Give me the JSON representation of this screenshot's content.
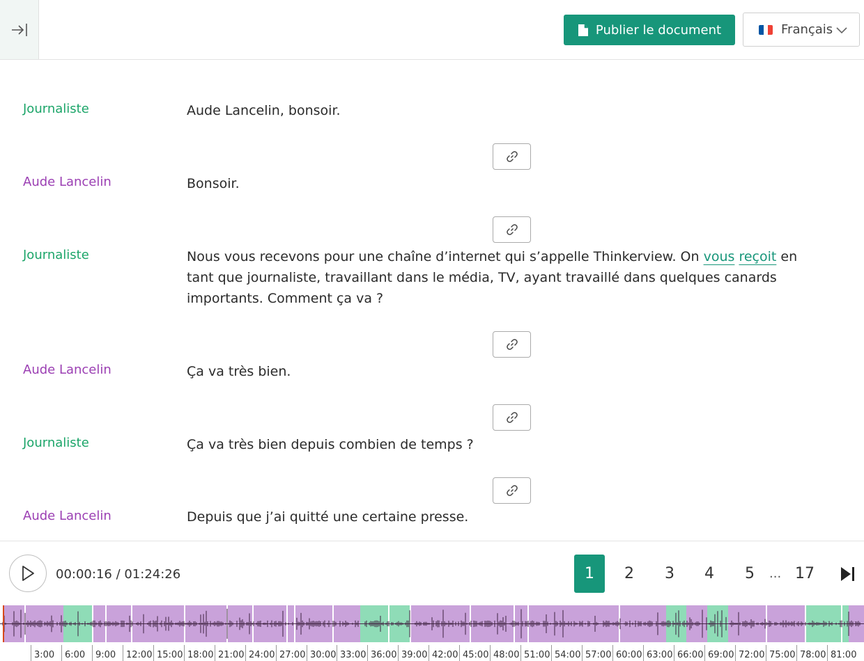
{
  "header": {
    "collapse_icon": "collapse-right-icon",
    "publish_label": "Publier le document",
    "publish_icon": "document-icon",
    "language": {
      "selected": "Français",
      "flag": "flag-fr-icon",
      "flag_colors": [
        "#0055a4",
        "#ffffff",
        "#ef4135"
      ]
    }
  },
  "colors": {
    "accent": "#17967a",
    "speaker_journaliste": "#1ca569",
    "speaker_guest": "#9b3fb3",
    "segment_purple": "#c9a2da",
    "segment_green": "#8fdcb7"
  },
  "transcript": [
    {
      "speaker": "Journaliste",
      "role": "j",
      "parts": [
        {
          "text": "Aude Lancelin, bonsoir."
        }
      ]
    },
    {
      "speaker": "Aude Lancelin",
      "role": "a",
      "parts": [
        {
          "text": "Bonsoir."
        }
      ]
    },
    {
      "speaker": "Journaliste",
      "role": "j",
      "parts": [
        {
          "text": "Nous vous recevons pour une chaîne d’internet qui s’appelle Thinkerview. On "
        },
        {
          "text": "vous",
          "highlight": true
        },
        {
          "text": " "
        },
        {
          "text": "reçoit",
          "highlight": true
        },
        {
          "text": " en tant que journaliste, travaillant dans le média, TV, ayant travaillé dans quelques canards importants. Comment ça va ?"
        }
      ]
    },
    {
      "speaker": "Aude Lancelin",
      "role": "a",
      "parts": [
        {
          "text": "Ça va très bien."
        }
      ]
    },
    {
      "speaker": "Journaliste",
      "role": "j",
      "parts": [
        {
          "text": "Ça va très bien depuis combien de temps ?"
        }
      ]
    },
    {
      "speaker": "Aude Lancelin",
      "role": "a",
      "parts": [
        {
          "text": "Depuis que j’ai quitté une certaine presse."
        }
      ]
    }
  ],
  "link_icon": "link-icon",
  "player": {
    "play_icon": "play-icon",
    "current_time": "00:00:16",
    "total_time": "01:24:26",
    "timecode": "00:00:16 / 01:24:26",
    "pages": [
      "1",
      "2",
      "3",
      "4",
      "5"
    ],
    "active_page": "1",
    "ellipsis": "...",
    "last_page": "17",
    "last_icon": "skip-to-end-icon",
    "timeline_labels": [
      "3:00",
      "6:00",
      "9:00",
      "12:00",
      "15:00",
      "18:00",
      "21:00",
      "24:00",
      "27:00",
      "30:00",
      "33:00",
      "36:00",
      "39:00",
      "42:00",
      "45:00",
      "48:00",
      "51:00",
      "54:00",
      "57:00",
      "60:00",
      "63:00",
      "66:00",
      "69:00",
      "72:00",
      "75:00",
      "78:00",
      "81:00"
    ]
  }
}
